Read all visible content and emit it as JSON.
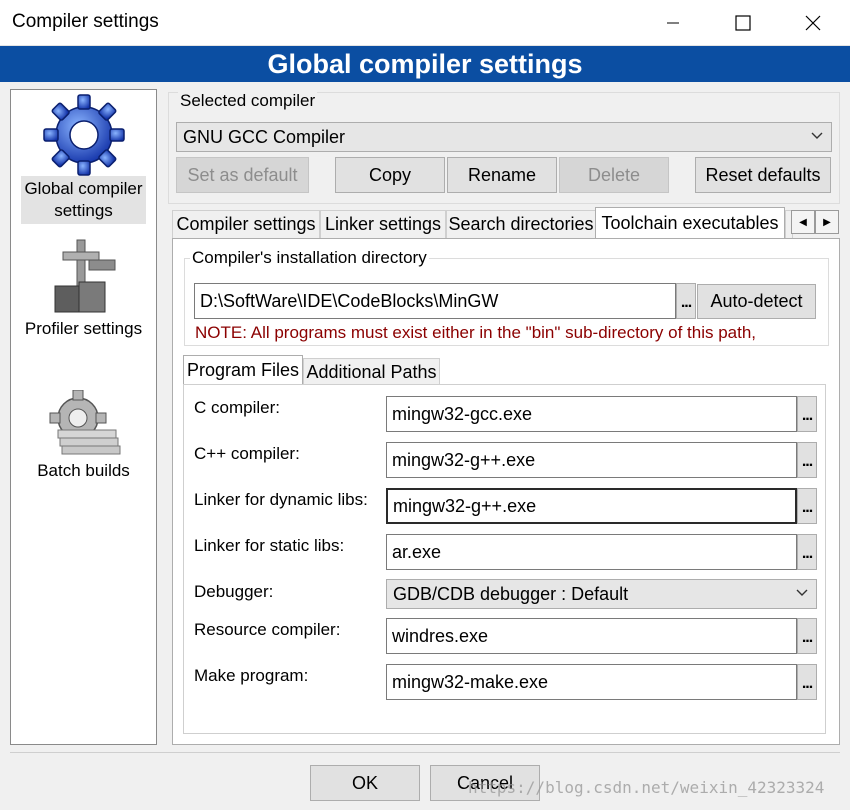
{
  "window": {
    "title": "Compiler settings"
  },
  "banner": {
    "title": "Global compiler settings"
  },
  "nav": {
    "global": "Global compiler settings",
    "profiler": "Profiler settings",
    "batch": "Batch builds"
  },
  "selected_compiler": {
    "label": "Selected compiler",
    "value": "GNU GCC Compiler"
  },
  "buttons": {
    "set_default": "Set as default",
    "copy": "Copy",
    "rename": "Rename",
    "delete": "Delete",
    "reset": "Reset defaults",
    "ok": "OK",
    "cancel": "Cancel"
  },
  "tabs": [
    "Compiler settings",
    "Linker settings",
    "Search directories",
    "Toolchain executables"
  ],
  "install_dir": {
    "label": "Compiler's installation directory",
    "value": "D:\\SoftWare\\IDE\\CodeBlocks\\MinGW",
    "browse": "...",
    "autodetect": "Auto-detect",
    "note": "NOTE: All programs must exist either in the \"bin\" sub-directory of this path,"
  },
  "subtabs": [
    "Program Files",
    "Additional Paths"
  ],
  "programs": {
    "c_label": "C compiler:",
    "c_value": "mingw32-gcc.exe",
    "cpp_label": "C++ compiler:",
    "cpp_value": "mingw32-g++.exe",
    "dyn_label": "Linker for dynamic libs:",
    "dyn_value": "mingw32-g++.exe",
    "static_label": "Linker for static libs:",
    "static_value": "ar.exe",
    "debugger_label": "Debugger:",
    "debugger_value": "GDB/CDB debugger : Default",
    "res_label": "Resource compiler:",
    "res_value": "windres.exe",
    "make_label": "Make program:",
    "make_value": "mingw32-make.exe",
    "browse": "..."
  },
  "watermark": "https://blog.csdn.net/weixin_42323324",
  "colors": {
    "banner": "#0b4ea2",
    "note": "#8b0000"
  }
}
